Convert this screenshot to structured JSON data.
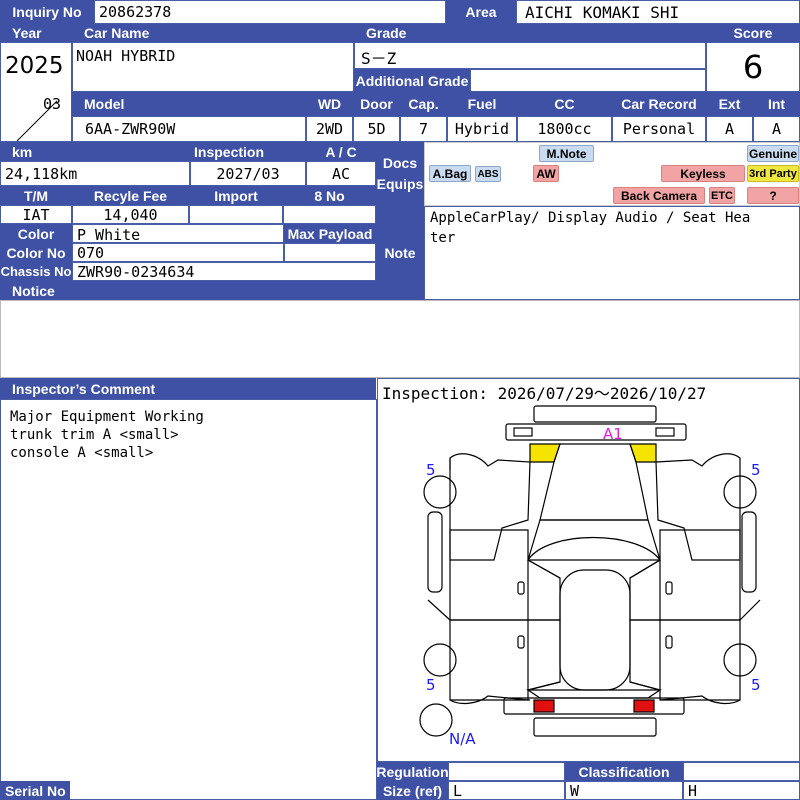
{
  "header": {
    "inquiry_label": "Inquiry No",
    "inquiry_value": "20862378",
    "area_label": "Area",
    "area_value": "AICHI KOMAKI SHI"
  },
  "row1": {
    "year_label": "Year",
    "year_value": "2025",
    "month_value": "03",
    "car_name_label": "Car Name",
    "car_name_value": "NOAH HYBRID",
    "grade_label": "Grade",
    "grade_value": "S－Z",
    "additional_grade_label": "Additional Grade",
    "additional_grade_value": "",
    "score_label": "Score",
    "score_value": "6"
  },
  "row2": {
    "model_label": "Model",
    "model_value": "6AA-ZWR90W",
    "wd_label": "WD",
    "wd_value": "2WD",
    "door_label": "Door",
    "door_value": "5D",
    "cap_label": "Cap.",
    "cap_value": "7",
    "fuel_label": "Fuel",
    "fuel_value": "Hybrid",
    "cc_label": "CC",
    "cc_value": "1800cc",
    "car_record_label": "Car Record",
    "car_record_value": "Personal",
    "ext_label": "Ext",
    "ext_value": "A",
    "int_label": "Int",
    "int_value": "A"
  },
  "details": {
    "km_label": "km",
    "km_value": "24,118km",
    "inspection_label": "Inspection",
    "inspection_value": "2027/03",
    "ac_label": "A / C",
    "ac_value": "AC",
    "tm_label": "T/M",
    "tm_value": "IAT",
    "recycle_label": "Recyle Fee",
    "recycle_value": "14,040",
    "import_label": "Import",
    "import_value": "",
    "eight_no_label": "8 No",
    "eight_no_value": "",
    "color_label": "Color",
    "color_value": "P White",
    "max_payload_label": "Max Payload",
    "max_payload_value": "",
    "color_no_label": "Color No",
    "color_no_value": "070",
    "chassis_label": "Chassis No",
    "chassis_value": "ZWR90-0234634",
    "notice_label": "Notice"
  },
  "equips": {
    "docs_label": "Docs",
    "equips_label": "Equips",
    "note_label": "Note",
    "note_value": "AppleCarPlay/ Display Audio / Seat Hea\nter",
    "badges": {
      "mnote": "M.Note",
      "genuine": "Genuine",
      "abag": "A.Bag",
      "abs": "ABS",
      "aw": "AW",
      "keyless": "Keyless",
      "third_party": "3rd Party",
      "back_camera": "Back Camera",
      "etc": "ETC",
      "question": "?"
    }
  },
  "comments": {
    "inspector_label": "Inspector’s Comment",
    "lines": "Major Equipment Working\ntrunk trim A <small>\nconsole A <small>",
    "inspection_period": "Inspection: 2026/07/29～2026/10/27"
  },
  "diagram": {
    "marks": {
      "a1": "A1",
      "tire_fl": "5",
      "tire_fr": "5",
      "tire_rl": "5",
      "tire_rr": "5",
      "spare": "N/A"
    },
    "colors": {
      "mark_blue": "#1a1aff",
      "mark_magenta": "#e020e0",
      "panel_yellow": "#f5e400",
      "lamp_red": "#e01010"
    }
  },
  "footer": {
    "regulation_label": "Regulation",
    "size_label": "Size (ref)",
    "size_l": "L",
    "classification_label": "Classification",
    "size_w": "W",
    "size_h": "H",
    "serial_label": "Serial No"
  }
}
